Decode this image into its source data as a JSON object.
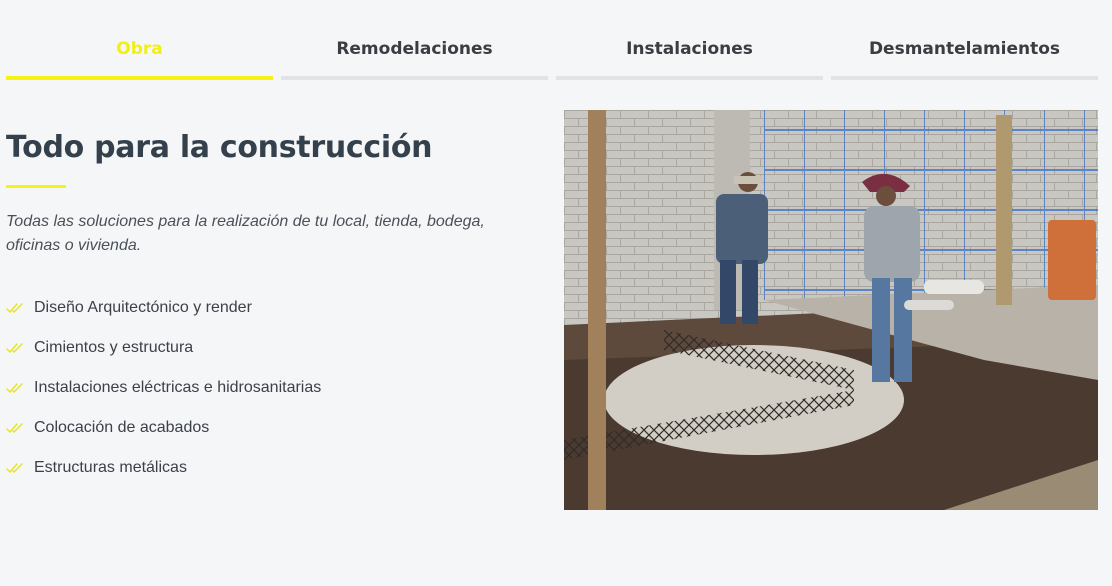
{
  "tabs": [
    {
      "label": "Obra",
      "active": true
    },
    {
      "label": "Remodelaciones",
      "active": false
    },
    {
      "label": "Instalaciones",
      "active": false
    },
    {
      "label": "Desmantelamientos",
      "active": false
    }
  ],
  "section": {
    "title": "Todo para la construcción",
    "subtitle": "Todas las soluciones para la realización de tu local, tienda, bodega, oficinas o vivienda."
  },
  "features": [
    {
      "label": "Diseño Arquitectónico y render",
      "icon": "double-check-icon"
    },
    {
      "label": "Cimientos y estructura",
      "icon": "double-check-icon"
    },
    {
      "label": "Instalaciones eléctricas e hidrosanitarias",
      "icon": "double-check-icon"
    },
    {
      "label": "Colocación de acabados",
      "icon": "double-check-icon"
    },
    {
      "label": "Estructuras metálicas",
      "icon": "double-check-icon"
    }
  ],
  "colors": {
    "accent": "#f5f214",
    "heading": "#34404b",
    "background": "#f4f6f8"
  }
}
